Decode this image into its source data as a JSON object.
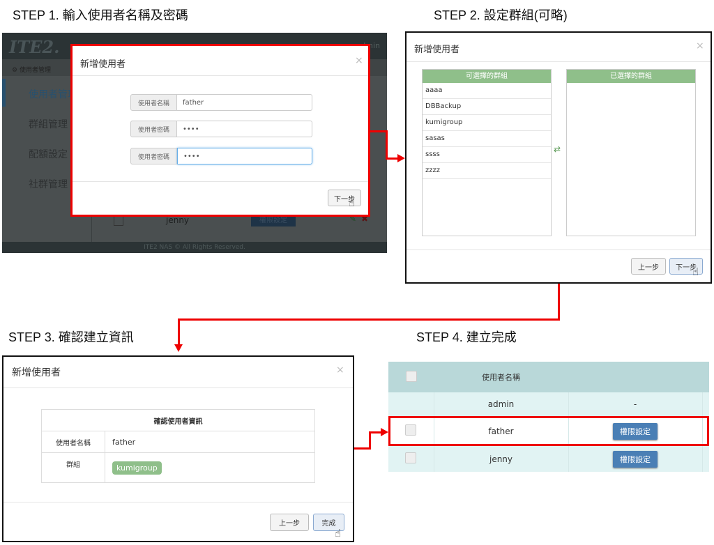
{
  "steps": {
    "s1": "STEP 1.  輸入使用者名稱及密碼",
    "s2": "STEP 2.  設定群組(可略)",
    "s3": "STEP 3.  確認建立資訊",
    "s4": "STEP 4.  建立完成"
  },
  "panel1": {
    "logo": "ITE2.",
    "user": "admin",
    "breadcrumb": "使用者管理",
    "sidebar": [
      "使用者管理",
      "群組管理",
      "配額設定",
      "社群管理"
    ],
    "bg_row_user": "jenny",
    "bg_row_button": "權限設定",
    "footer": "ITE2 NAS © All Rights Reserved.",
    "modal": {
      "title": "新增使用者",
      "close": "×",
      "fields": [
        {
          "label": "使用者名稱",
          "value": "father"
        },
        {
          "label": "使用者密碼",
          "value": "••••"
        },
        {
          "label": "使用者密碼",
          "value": "••••"
        }
      ],
      "next": "下一步"
    }
  },
  "panel2": {
    "title": "新增使用者",
    "close": "×",
    "available_header": "可選擇的群組",
    "selected_header": "已選擇的群組",
    "available": [
      "aaaa",
      "DBBackup",
      "kumigroup",
      "sasas",
      "ssss",
      "zzzz"
    ],
    "swap_icon": "⇄",
    "prev": "上一步",
    "next": "下一步"
  },
  "panel3": {
    "title": "新增使用者",
    "close": "×",
    "table_title": "確認使用者資訊",
    "username_label": "使用者名稱",
    "username": "father",
    "group_label": "群組",
    "group": "kumigroup",
    "prev": "上一步",
    "done": "完成"
  },
  "panel4": {
    "header": "使用者名稱",
    "rows": [
      {
        "name": "admin",
        "action": "-"
      },
      {
        "name": "father",
        "action": "權限設定"
      },
      {
        "name": "jenny",
        "action": "權限設定"
      }
    ]
  },
  "colors": {
    "highlight": "#ee0000",
    "group_green": "#8fbf8a",
    "button_blue": "#4a7fb5"
  }
}
